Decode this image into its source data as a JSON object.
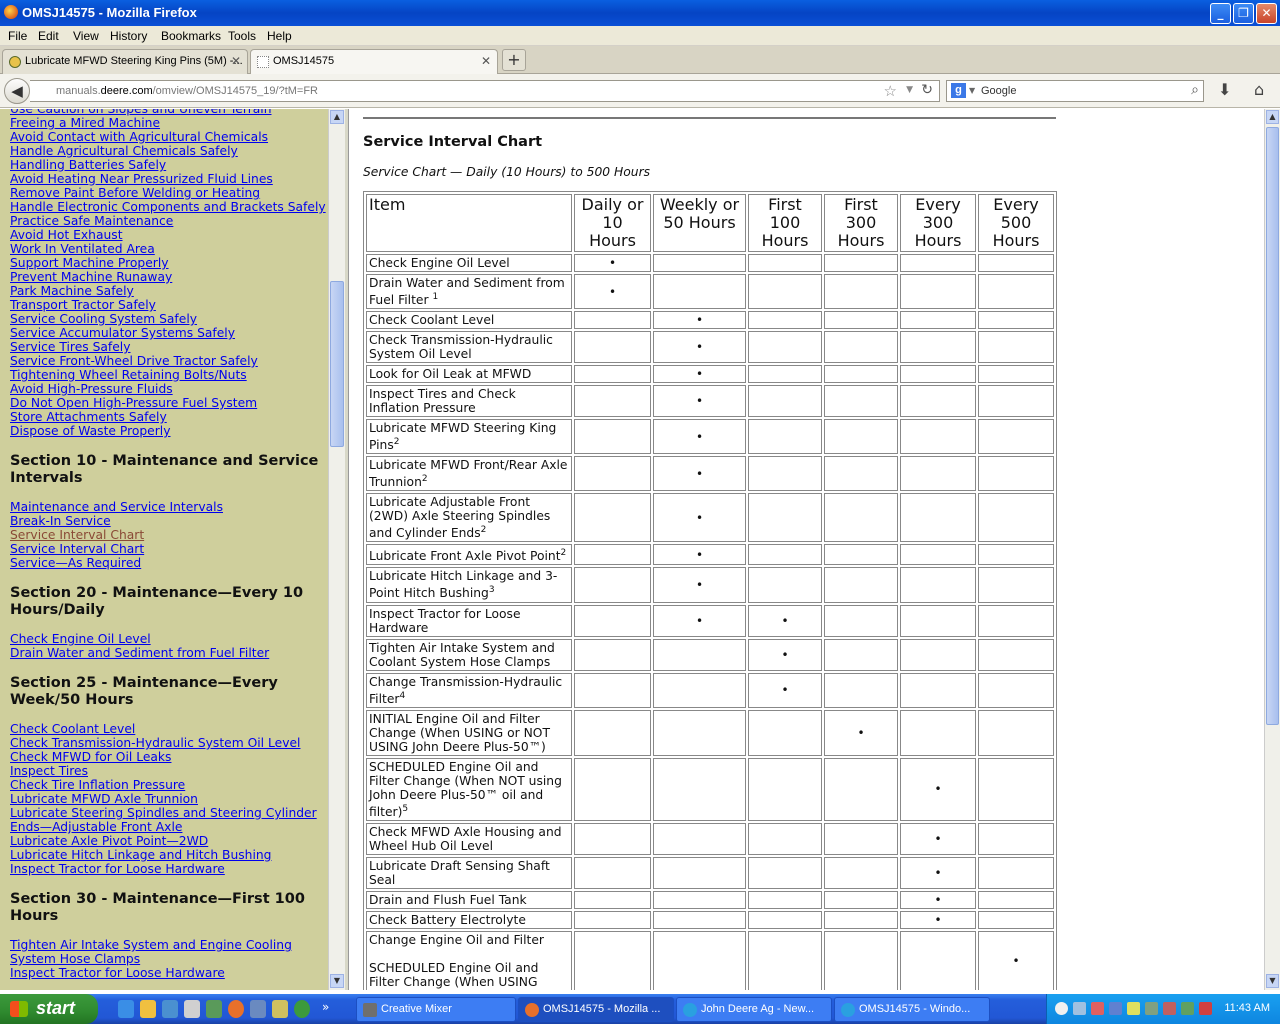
{
  "window": {
    "title": "OMSJ14575 - Mozilla Firefox",
    "minimize": "_",
    "restore": "❐",
    "close": "✕"
  },
  "menu": [
    "File",
    "Edit",
    "View",
    "History",
    "Bookmarks",
    "Tools",
    "Help"
  ],
  "tabs": [
    {
      "label": "Lubricate MFWD Steering King Pins (5M) -...",
      "active": false
    },
    {
      "label": "OMSJ14575",
      "active": true
    }
  ],
  "new_tab": "+",
  "address": {
    "url_prefix": "manuals.",
    "url_domain": "deere.com",
    "url_rest": "/omview/OMSJ14575_19/?tM=FR"
  },
  "search": {
    "engine_letter": "g",
    "placeholder": "Google"
  },
  "sidebar": {
    "groups": [
      {
        "heading": "",
        "links": [
          {
            "label": "Use Caution on Slopes and Uneven Terrain",
            "visited": false
          },
          {
            "label": "Freeing a Mired Machine",
            "visited": false
          },
          {
            "label": "Avoid Contact with Agricultural Chemicals",
            "visited": false
          },
          {
            "label": "Handle Agricultural Chemicals Safely",
            "visited": false
          },
          {
            "label": "Handling Batteries Safely",
            "visited": false
          },
          {
            "label": "Avoid Heating Near Pressurized Fluid Lines",
            "visited": false
          },
          {
            "label": "Remove Paint Before Welding or Heating",
            "visited": false
          },
          {
            "label": "Handle Electronic Components and Brackets Safely",
            "visited": false
          },
          {
            "label": "Practice Safe Maintenance",
            "visited": false
          },
          {
            "label": "Avoid Hot Exhaust",
            "visited": false
          },
          {
            "label": "Work In Ventilated Area",
            "visited": false
          },
          {
            "label": "Support Machine Properly",
            "visited": false
          },
          {
            "label": "Prevent Machine Runaway",
            "visited": false
          },
          {
            "label": "Park Machine Safely",
            "visited": false
          },
          {
            "label": "Transport Tractor Safely",
            "visited": false
          },
          {
            "label": "Service Cooling System Safely",
            "visited": false
          },
          {
            "label": "Service Accumulator Systems Safely",
            "visited": false
          },
          {
            "label": "Service Tires Safely",
            "visited": false
          },
          {
            "label": "Service Front-Wheel Drive Tractor Safely",
            "visited": false
          },
          {
            "label": "Tightening Wheel Retaining Bolts/Nuts",
            "visited": false
          },
          {
            "label": "Avoid High-Pressure Fluids",
            "visited": false
          },
          {
            "label": "Do Not Open High-Pressure Fuel System",
            "visited": false
          },
          {
            "label": "Store Attachments Safely",
            "visited": false
          },
          {
            "label": "Dispose of Waste Properly",
            "visited": false
          }
        ]
      },
      {
        "heading": "Section 10 - Maintenance and Service Intervals",
        "links": [
          {
            "label": "Maintenance and Service Intervals",
            "visited": false
          },
          {
            "label": "Break-In Service",
            "visited": false
          },
          {
            "label": "Service Interval Chart",
            "visited": true
          },
          {
            "label": "Service Interval Chart",
            "visited": false
          },
          {
            "label": "Service—As Required",
            "visited": false
          }
        ]
      },
      {
        "heading": "Section 20 - Maintenance—Every 10 Hours/Daily",
        "links": [
          {
            "label": "Check Engine Oil Level",
            "visited": false
          },
          {
            "label": "Drain Water and Sediment from Fuel Filter",
            "visited": false
          }
        ]
      },
      {
        "heading": "Section 25 - Maintenance—Every Week/50 Hours",
        "links": [
          {
            "label": "Check Coolant Level",
            "visited": false
          },
          {
            "label": "Check Transmission-Hydraulic System Oil Level",
            "visited": false
          },
          {
            "label": "Check MFWD for Oil Leaks",
            "visited": false
          },
          {
            "label": "Inspect Tires",
            "visited": false
          },
          {
            "label": "Check Tire Inflation Pressure",
            "visited": false
          },
          {
            "label": "Lubricate MFWD Axle Trunnion",
            "visited": false
          },
          {
            "label": "Lubricate Steering Spindles and Steering Cylinder Ends—Adjustable Front Axle",
            "visited": false
          },
          {
            "label": "Lubricate Axle Pivot Point—2WD",
            "visited": false
          },
          {
            "label": "Lubricate Hitch Linkage and Hitch Bushing",
            "visited": false
          },
          {
            "label": "Inspect Tractor for Loose Hardware",
            "visited": false
          }
        ]
      },
      {
        "heading": "Section 30 - Maintenance—First 100 Hours",
        "links": [
          {
            "label": "Tighten Air Intake System and Engine Cooling System Hose Clamps",
            "visited": false
          },
          {
            "label": "Inspect Tractor for Loose Hardware",
            "visited": false
          }
        ]
      }
    ]
  },
  "main": {
    "heading": "Service Interval Chart",
    "subtitle": "Service Chart — Daily (10 Hours) to 500 Hours",
    "columns": [
      "Item",
      "Daily or 10 Hours",
      "Weekly or 50 Hours",
      "First 100 Hours",
      "First 300 Hours",
      "Every 300 Hours",
      "Every 500 Hours"
    ],
    "mark_symbol": "•",
    "rows": [
      {
        "item": "Check Engine Oil Level",
        "sup": "",
        "marks": [
          1,
          0,
          0,
          0,
          0,
          0
        ]
      },
      {
        "item": "Drain Water and Sediment from Fuel Filter ",
        "sup": "1",
        "marks": [
          1,
          0,
          0,
          0,
          0,
          0
        ]
      },
      {
        "item": "Check Coolant Level",
        "sup": "",
        "marks": [
          0,
          1,
          0,
          0,
          0,
          0
        ]
      },
      {
        "item": "Check Transmission-Hydraulic System Oil Level",
        "sup": "",
        "marks": [
          0,
          1,
          0,
          0,
          0,
          0
        ]
      },
      {
        "item": "Look for Oil Leak at MFWD",
        "sup": "",
        "marks": [
          0,
          1,
          0,
          0,
          0,
          0
        ]
      },
      {
        "item": "Inspect Tires and Check Inflation Pressure",
        "sup": "",
        "marks": [
          0,
          1,
          0,
          0,
          0,
          0
        ]
      },
      {
        "item": "Lubricate MFWD Steering King Pins",
        "sup": "2",
        "marks": [
          0,
          1,
          0,
          0,
          0,
          0
        ]
      },
      {
        "item": "Lubricate MFWD Front/Rear Axle Trunnion",
        "sup": "2",
        "marks": [
          0,
          1,
          0,
          0,
          0,
          0
        ]
      },
      {
        "item": "Lubricate Adjustable Front (2WD) Axle Steering Spindles and Cylinder Ends",
        "sup": "2",
        "marks": [
          0,
          1,
          0,
          0,
          0,
          0
        ]
      },
      {
        "item": "Lubricate Front Axle Pivot Point",
        "sup": "2",
        "marks": [
          0,
          1,
          0,
          0,
          0,
          0
        ]
      },
      {
        "item": "Lubricate Hitch Linkage and 3-Point Hitch Bushing",
        "sup": "3",
        "marks": [
          0,
          1,
          0,
          0,
          0,
          0
        ]
      },
      {
        "item": "Inspect Tractor for Loose Hardware",
        "sup": "",
        "marks": [
          0,
          1,
          1,
          0,
          0,
          0
        ]
      },
      {
        "item": "Tighten Air Intake System and Coolant System Hose Clamps",
        "sup": "",
        "marks": [
          0,
          0,
          1,
          0,
          0,
          0
        ]
      },
      {
        "item": "Change Transmission-Hydraulic Filter",
        "sup": "4",
        "marks": [
          0,
          0,
          1,
          0,
          0,
          0
        ]
      },
      {
        "item": "INITIAL Engine Oil and Filter Change (When USING or NOT USING John Deere Plus-50™)",
        "sup": "",
        "marks": [
          0,
          0,
          0,
          1,
          0,
          0
        ]
      },
      {
        "item": "SCHEDULED Engine Oil and Filter Change (When NOT using John Deere Plus-50™ oil and filter)",
        "sup": "5",
        "marks": [
          0,
          0,
          0,
          0,
          1,
          0
        ]
      },
      {
        "item": "Check MFWD Axle Housing and Wheel Hub Oil Level",
        "sup": "",
        "marks": [
          0,
          0,
          0,
          0,
          1,
          0
        ]
      },
      {
        "item": "Lubricate Draft Sensing Shaft Seal",
        "sup": "",
        "marks": [
          0,
          0,
          0,
          0,
          1,
          0
        ]
      },
      {
        "item": "Drain and Flush Fuel Tank",
        "sup": "",
        "marks": [
          0,
          0,
          0,
          0,
          1,
          0
        ]
      },
      {
        "item": "Check Battery Electrolyte",
        "sup": "",
        "marks": [
          0,
          0,
          0,
          0,
          1,
          0
        ]
      },
      {
        "item": "Change Engine Oil and Filter\n\nSCHEDULED Engine Oil and Filter Change (When USING",
        "sup": "",
        "marks": [
          0,
          0,
          0,
          0,
          0,
          1
        ]
      }
    ]
  },
  "taskbar": {
    "start": "start",
    "tasks": [
      {
        "label": "Creative Mixer",
        "active": false,
        "color": "#6f6f6f"
      },
      {
        "label": "OMSJ14575 - Mozilla ...",
        "active": true,
        "color": "#e8702a"
      },
      {
        "label": "John Deere Ag - New...",
        "active": false,
        "color": "#2aa0e0"
      },
      {
        "label": "OMSJ14575 - Windo...",
        "active": false,
        "color": "#2aa0e0"
      }
    ],
    "clock": "11:43 AM"
  },
  "colors": {
    "sidebar_bg": "#cfcf9c",
    "link": "#0000ee",
    "visited_link": "#8a4a36",
    "titlebar_blue": "#0a5fe0"
  }
}
